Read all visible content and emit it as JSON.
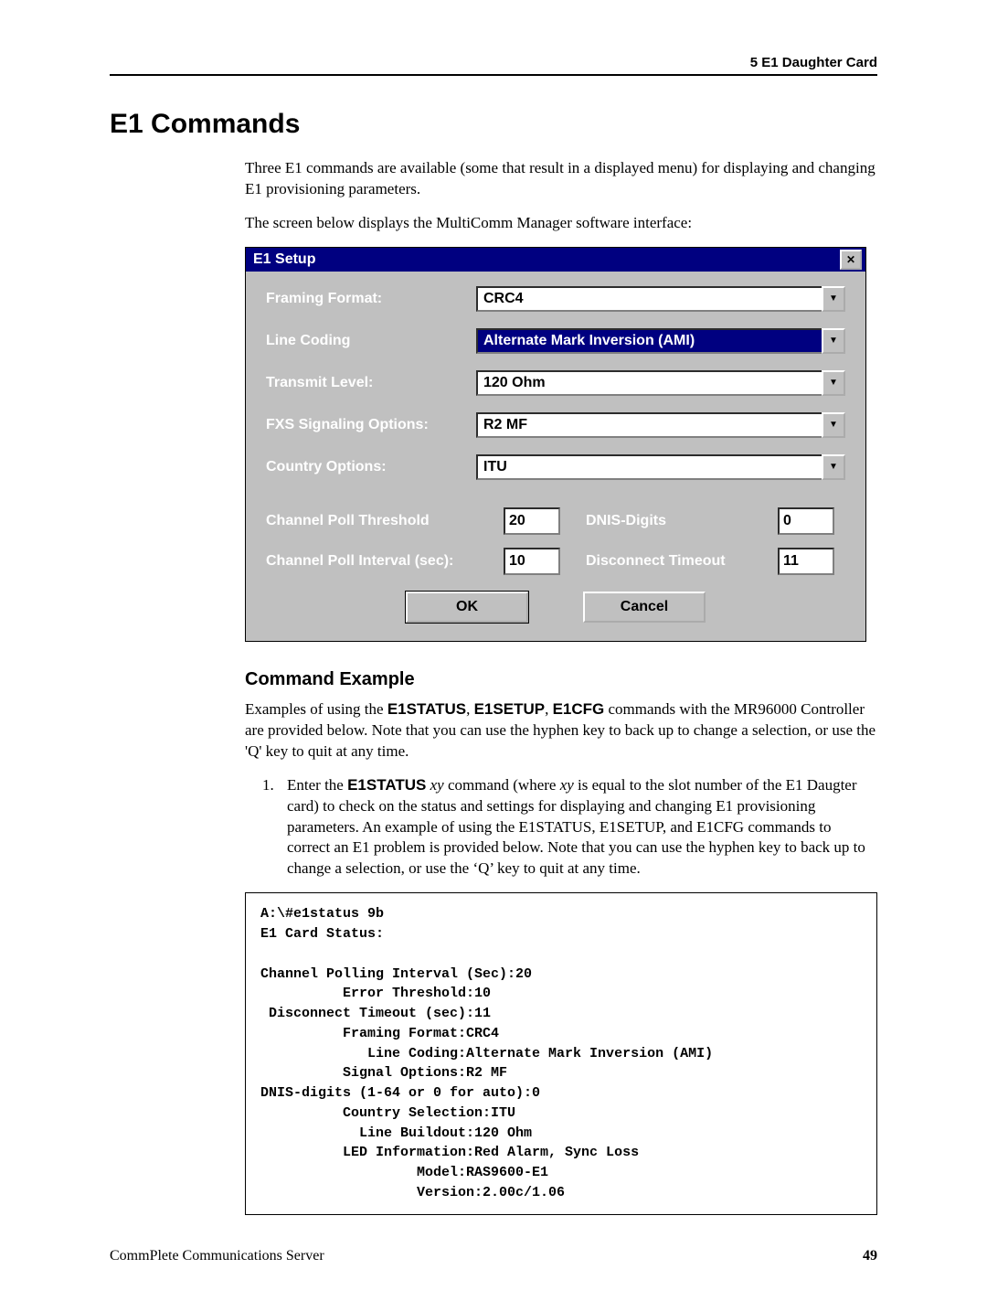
{
  "header": {
    "chapter_line": "5   E1 Daughter Card"
  },
  "title": "E1 Commands",
  "intro_p1": "Three E1 commands are available (some that result in a displayed menu) for displaying and changing E1 provisioning parameters.",
  "intro_p2": "The screen below displays the MultiComm Manager software interface:",
  "dialog": {
    "title": "E1 Setup",
    "close_x": "✕",
    "framing_lbl": "Framing Format:",
    "framing_val": "CRC4",
    "linecoding_lbl": "Line Coding",
    "linecoding_val": "Alternate Mark Inversion (AMI)",
    "txlevel_lbl": "Transmit Level:",
    "txlevel_val": "120 Ohm",
    "fxs_lbl": "FXS Signaling Options:",
    "fxs_val": "R2 MF",
    "country_lbl": "Country Options:",
    "country_val": "ITU",
    "poll_thresh_lbl": "Channel Poll Threshold",
    "poll_thresh_val": "20",
    "dnis_lbl": "DNIS-Digits",
    "dnis_val": "0",
    "poll_int_lbl": "Channel Poll Interval (sec):",
    "poll_int_val": "10",
    "disc_lbl": "Disconnect Timeout",
    "disc_val": "11",
    "ok_label": "OK",
    "cancel_label": "Cancel"
  },
  "cmd_example_heading": "Command Example",
  "cmd_example_p1a": "Examples of using the ",
  "cmd_example_p1_cmd1": "E1STATUS",
  "cmd_example_p1b": ", ",
  "cmd_example_p1_cmd2": "E1SETUP",
  "cmd_example_p1c": ", ",
  "cmd_example_p1_cmd3": "E1CFG",
  "cmd_example_p1d": " commands with the MR96000 Controller are provided below. Note that you can use the hyphen key to back up to change a selection, or use the 'Q' key to quit at any time.",
  "step1a": "Enter the ",
  "step1_cmd": "E1STATUS",
  "step1b": " ",
  "step1_var": "xy",
  "step1c": " command (where ",
  "step1_var2": "xy",
  "step1d": " is equal to the slot number of the E1 Daugter card) to check on the status and settings for displaying and changing E1 provisioning parameters. An example of using the E1STATUS, E1SETUP, and E1CFG commands to correct an E1 problem is provided below. Note that you can use the hyphen key to back up to change a selection, or use the ‘Q’ key to quit at any time.",
  "terminal": "A:\\#e1status 9b\nE1 Card Status:\n\nChannel Polling Interval (Sec):20\n          Error Threshold:10\n Disconnect Timeout (sec):11\n          Framing Format:CRC4\n             Line Coding:Alternate Mark Inversion (AMI)\n          Signal Options:R2 MF\nDNIS-digits (1-64 or 0 for auto):0\n          Country Selection:ITU\n            Line Buildout:120 Ohm\n          LED Information:Red Alarm, Sync Loss\n                   Model:RAS9600-E1\n                   Version:2.00c/1.06",
  "footer": {
    "product": "CommPlete Communications Server",
    "page": "49"
  }
}
